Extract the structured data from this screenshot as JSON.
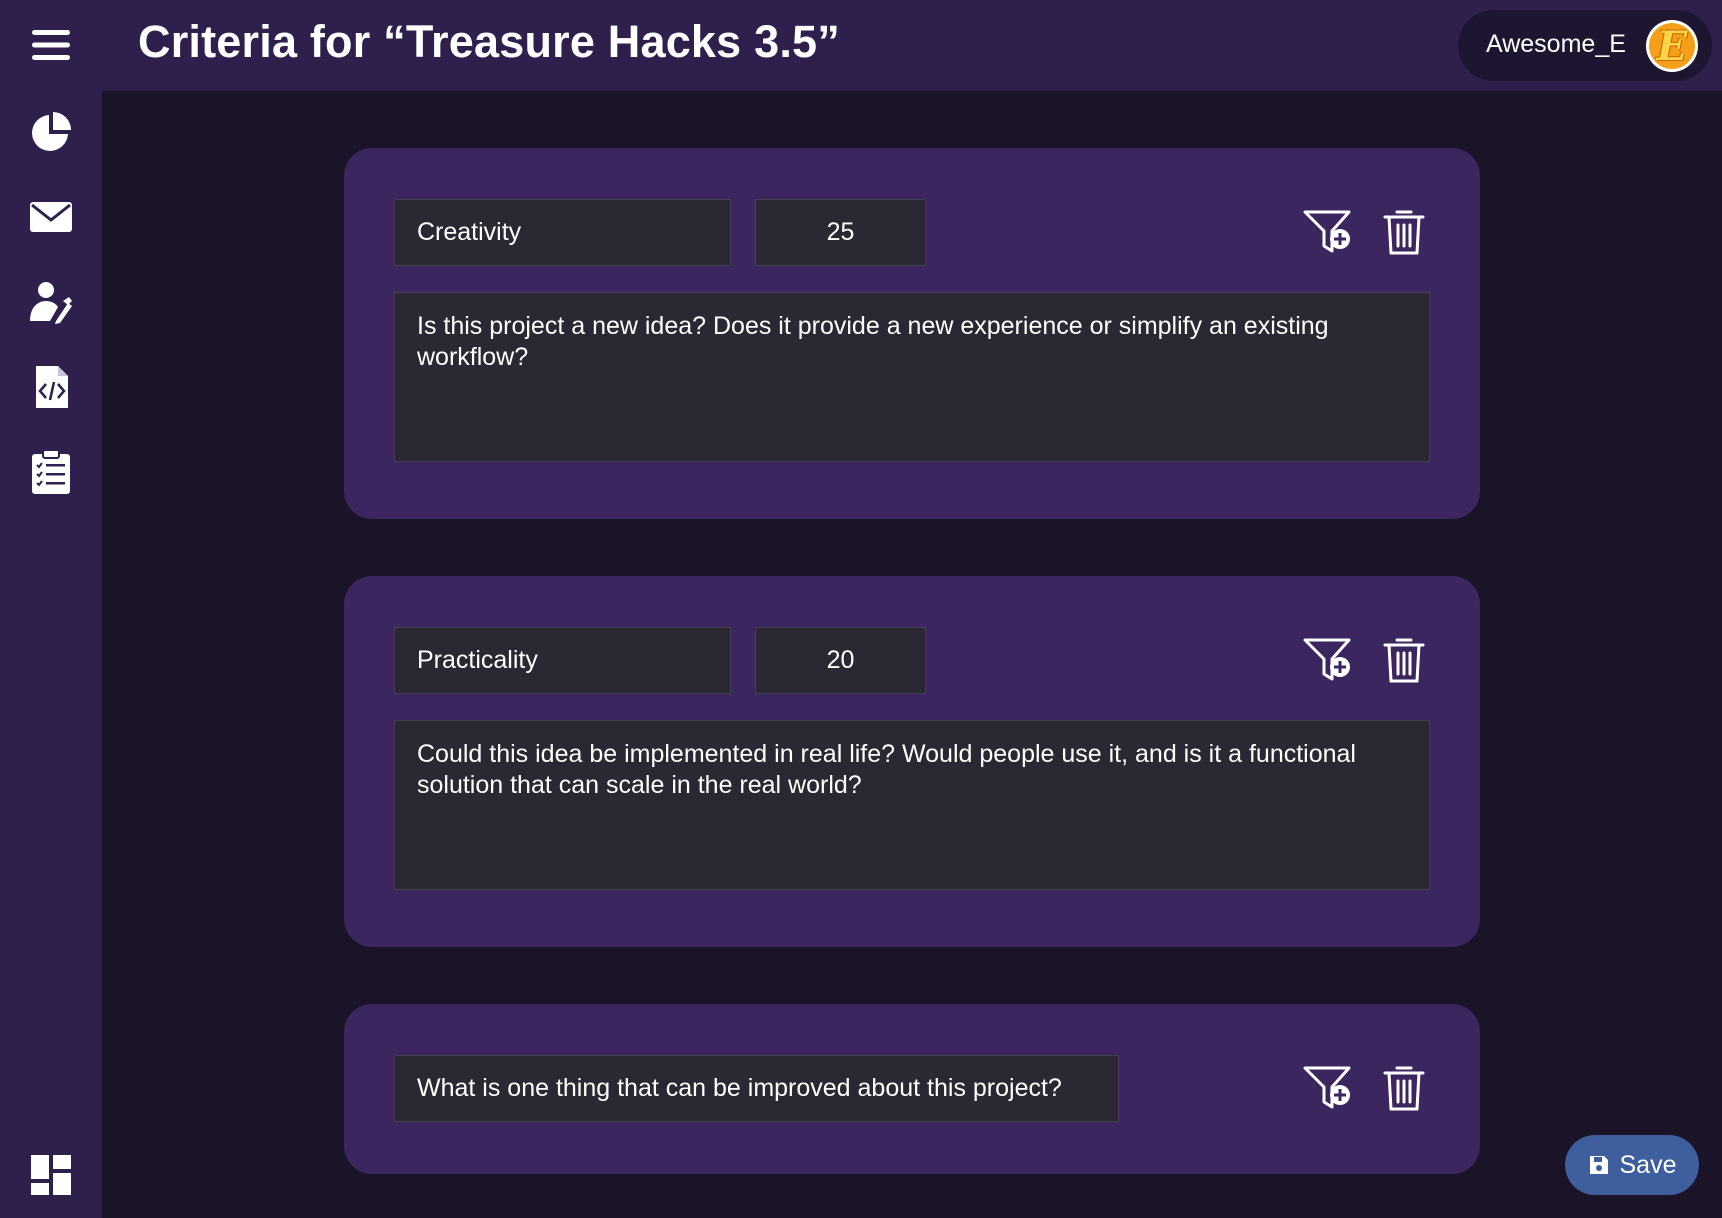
{
  "header": {
    "title": "Criteria for “Treasure Hacks 3.5”",
    "user_name": "Awesome_E",
    "avatar_letter": "E"
  },
  "sidebar": {
    "items": [
      {
        "icon": "menu-icon"
      },
      {
        "icon": "pie-chart-icon"
      },
      {
        "icon": "mail-icon"
      },
      {
        "icon": "judge-icon"
      },
      {
        "icon": "code-file-icon"
      },
      {
        "icon": "checklist-icon"
      },
      {
        "icon": "dashboard-icon"
      }
    ]
  },
  "criteria": [
    {
      "name": "Creativity",
      "weight": "25",
      "description": "Is this project a new idea? Does it provide a new experience or simplify an existing workflow?"
    },
    {
      "name": "Practicality",
      "weight": "20",
      "description": "Could this idea be implemented in real life? Would people use it, and is it a functional solution that can scale in the real world?"
    }
  ],
  "question": {
    "text": "What is one thing that can be improved about this project?"
  },
  "actions": {
    "save_label": "Save"
  },
  "colors": {
    "background": "#1b1429",
    "chrome": "#2f1f4d",
    "card": "#3b2660",
    "field": "#2b2833",
    "save_button": "#3f5e9e",
    "avatar": "#f6a019"
  }
}
